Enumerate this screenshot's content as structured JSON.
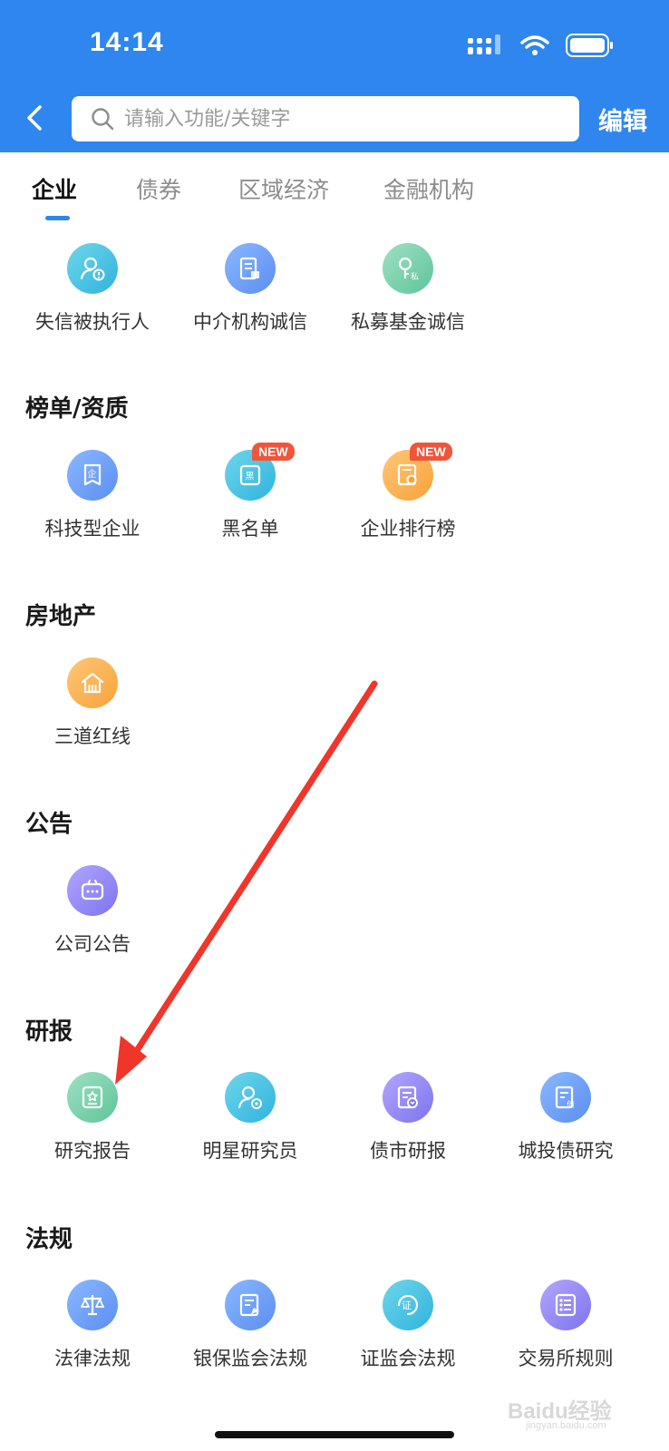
{
  "status_bar": {
    "time": "14:14"
  },
  "header": {
    "search_placeholder": "请输入功能/关键字",
    "edit_label": "编辑"
  },
  "tabs": [
    {
      "label": "企业",
      "active": true
    },
    {
      "label": "债券",
      "active": false
    },
    {
      "label": "区域经济",
      "active": false
    },
    {
      "label": "金融机构",
      "active": false
    }
  ],
  "sections": {
    "company": {
      "items": [
        {
          "label": "失信被执行人",
          "icon": "person-alert-icon",
          "color": "#35b5e0"
        },
        {
          "label": "中介机构诚信",
          "icon": "document-icon",
          "color": "#5b8ef0"
        },
        {
          "label": "私募基金诚信",
          "icon": "private-fund-icon",
          "color": "#5ec49a"
        }
      ]
    },
    "rankings": {
      "title": "榜单/资质",
      "items": [
        {
          "label": "科技型企业",
          "icon": "enterprise-badge-icon",
          "color": "#5b8ef0"
        },
        {
          "label": "黑名单",
          "icon": "blacklist-icon",
          "color": "#35b5e0",
          "badge": "NEW"
        },
        {
          "label": "企业排行榜",
          "icon": "ranking-certificate-icon",
          "color": "#f7a239",
          "badge": "NEW"
        }
      ]
    },
    "real_estate": {
      "title": "房地产",
      "items": [
        {
          "label": "三道红线",
          "icon": "house-icon",
          "color": "#f7a239"
        }
      ]
    },
    "announcements": {
      "title": "公告",
      "items": [
        {
          "label": "公司公告",
          "icon": "chat-bubble-icon",
          "color": "#7d74ee"
        }
      ]
    },
    "research": {
      "title": "研报",
      "items": [
        {
          "label": "研究报告",
          "icon": "report-icon",
          "color": "#5ec49a"
        },
        {
          "label": "明星研究员",
          "icon": "researcher-icon",
          "color": "#35b5e0"
        },
        {
          "label": "债市研报",
          "icon": "bond-report-icon",
          "color": "#7d74ee"
        },
        {
          "label": "城投债研究",
          "icon": "city-bond-icon",
          "color": "#5b8ef0"
        }
      ]
    },
    "regulations": {
      "title": "法规",
      "items": [
        {
          "label": "法律法规",
          "icon": "scales-icon",
          "color": "#5b8ef0"
        },
        {
          "label": "银保监会法规",
          "icon": "insurance-doc-icon",
          "color": "#5b8ef0"
        },
        {
          "label": "证监会法规",
          "icon": "certificate-icon",
          "color": "#35b5e0"
        },
        {
          "label": "交易所规则",
          "icon": "exchange-rules-icon",
          "color": "#7d74ee"
        }
      ]
    }
  },
  "watermark": {
    "brand": "Baidu经验",
    "sub": "jingyan.baidu.com"
  },
  "colors": {
    "primary": "#2e86ee",
    "annotation_arrow": "#f0352a",
    "badge": "#f0553a"
  }
}
